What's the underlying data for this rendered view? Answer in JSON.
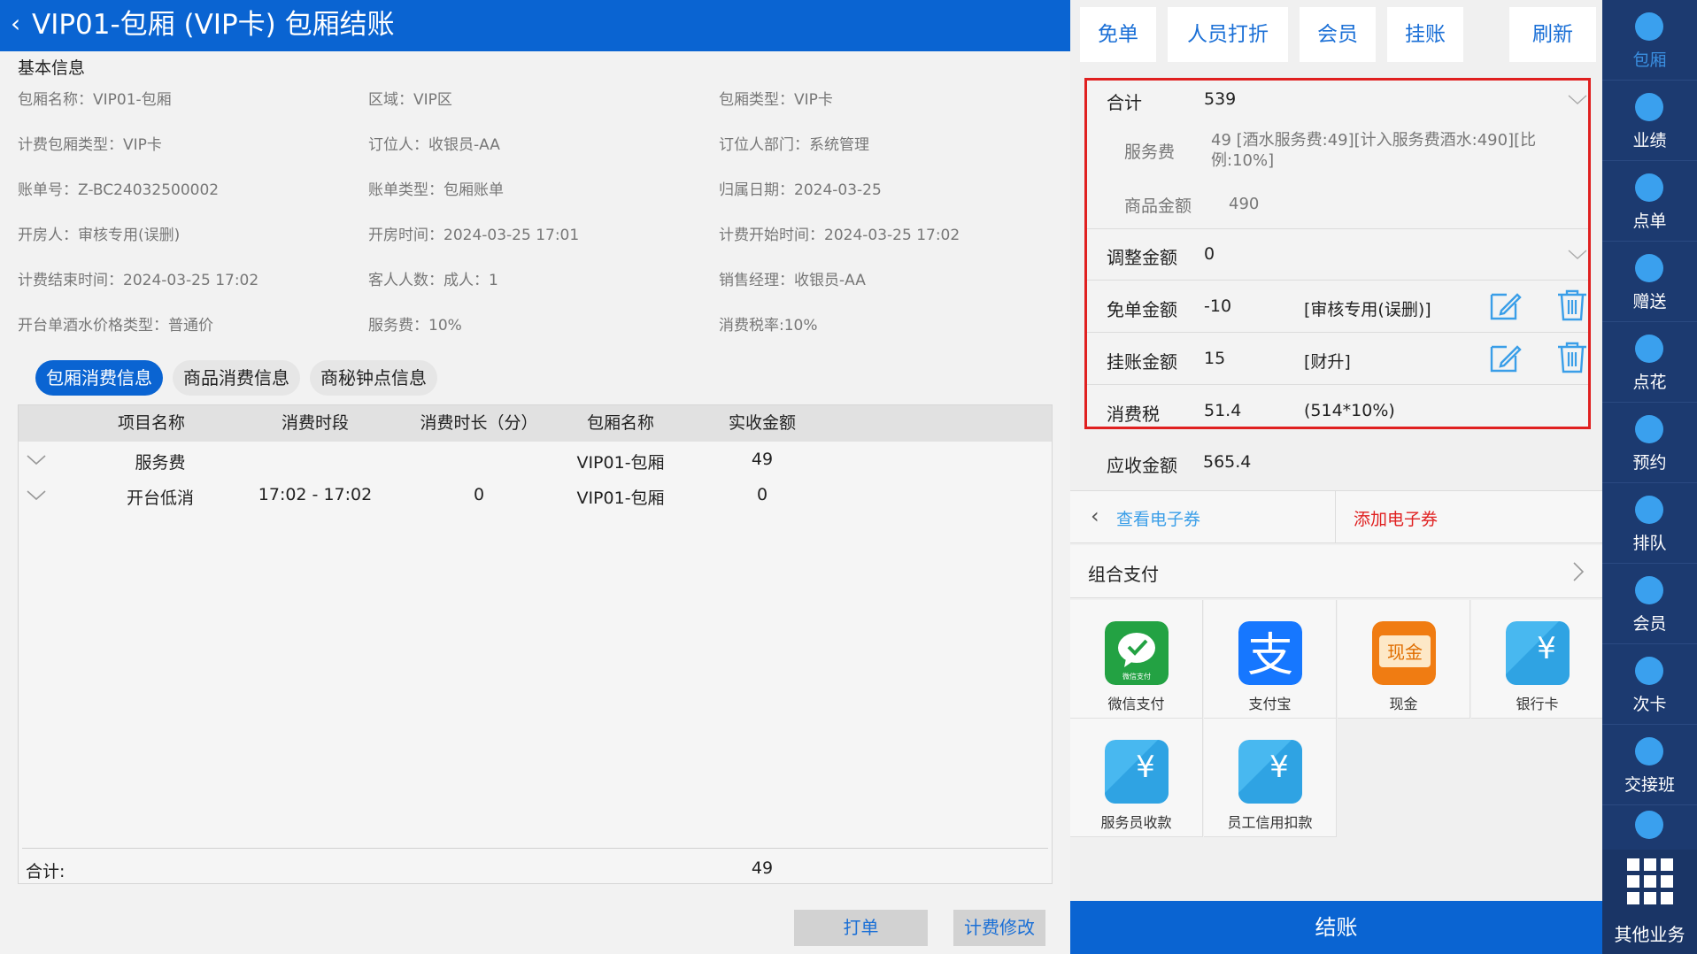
{
  "header": {
    "back_icon": "chevron-left-icon",
    "title": "VIP01-包厢 (VIP卡) 包厢结账"
  },
  "basic_info": {
    "section_title": "基本信息",
    "fields": [
      "包厢名称：VIP01-包厢",
      "区域：VIP区",
      "包厢类型：VIP卡",
      "计费包厢类型：VIP卡",
      "订位人：收银员-AA",
      "订位人部门：系统管理",
      "账单号：Z-BC24032500002",
      "账单类型：包厢账单",
      "归属日期：2024-03-25",
      "开房人：审核专用(误删)",
      "开房时间：2024-03-25 17:01",
      "计费开始时间：2024-03-25 17:02",
      "计费结束时间：2024-03-25 17:02",
      "客人人数：成人：1",
      "销售经理：收银员-AA",
      "开台单酒水价格类型：普通价",
      "服务费：10%",
      "消费税率:10%"
    ]
  },
  "tabs": [
    "包厢消费信息",
    "商品消费信息",
    "商秘钟点信息"
  ],
  "table": {
    "headers": [
      "项目名称",
      "消费时段",
      "消费时长（分）",
      "包厢名称",
      "实收金额"
    ],
    "rows": [
      [
        "服务费",
        "",
        "",
        "VIP01-包厢",
        "49"
      ],
      [
        "开台低消",
        "17:02 - 17:02",
        "0",
        "VIP01-包厢",
        "0"
      ]
    ],
    "footer_label": "合计:",
    "footer_value": "49"
  },
  "left_buttons": [
    "打单",
    "计费修改"
  ],
  "top_buttons": [
    "免单",
    "人员打折",
    "会员",
    "挂账",
    "刷新"
  ],
  "summary": {
    "total_label": "合计",
    "total_value": "539",
    "service_label": "服务费",
    "service_value": "49 [酒水服务费:49][计入服务费酒水:490][比例:10%]",
    "goods_label": "商品金额",
    "goods_value": "490",
    "adjust_label": "调整金额",
    "adjust_value": "0",
    "free_label": "免单金额",
    "free_value": "-10",
    "free_note": "[审核专用(误删)]",
    "credit_label": "挂账金额",
    "credit_value": "15",
    "credit_note": "[财升]",
    "tax_label": "消费税",
    "tax_value": "51.4",
    "tax_note": "(514*10%)"
  },
  "receivable": {
    "label": "应收金额",
    "value": "565.4"
  },
  "coupons": {
    "view": "查看电子券",
    "add": "添加电子券"
  },
  "combo_pay": "组合支付",
  "payments": [
    "微信支付",
    "支付宝",
    "现金",
    "银行卡",
    "服务员收款",
    "员工信用扣款"
  ],
  "payment_icon_text": {
    "wechat_small": "微信支付",
    "alipay": "支",
    "cash": "现金",
    "yen": "¥"
  },
  "checkout": "结账",
  "sidebar": [
    "包厢",
    "业绩",
    "点单",
    "赠送",
    "点花",
    "预约",
    "排队",
    "会员",
    "次卡",
    "交接班",
    "",
    "其他业务"
  ],
  "colors": {
    "primary": "#0a64d2",
    "sidebar": "#1c3a70",
    "highlight_border": "#e02020",
    "add_coupon": "#e02020",
    "link": "#1a6fd6"
  }
}
